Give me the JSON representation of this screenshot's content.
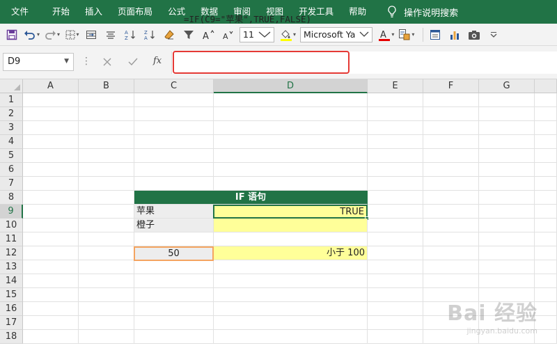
{
  "ribbon": {
    "tabs": [
      "文件",
      "开始",
      "插入",
      "页面布局",
      "公式",
      "数据",
      "审阅",
      "视图",
      "开发工具",
      "帮助"
    ],
    "search_label": "操作说明搜索",
    "color": "#217346"
  },
  "toolbar": {
    "font_size": "11",
    "font_name": "Microsoft Ya",
    "icons": [
      "save-icon",
      "undo-icon",
      "redo-icon",
      "borders-icon",
      "merge-icon",
      "align-icon",
      "sort-asc-icon",
      "sort-desc-icon",
      "clear-icon",
      "filter-icon",
      "font-grow-icon",
      "font-shrink-icon",
      "fill-color-icon",
      "font-color-icon",
      "format-painter-icon",
      "form-icon",
      "chart-icon",
      "camera-icon",
      "more-icon"
    ]
  },
  "formula_bar": {
    "name_box": "D9",
    "formula": "=IF(C9=\"苹果\",TRUE,FALSE)",
    "fx_label": "fx"
  },
  "sheet": {
    "columns": [
      "A",
      "B",
      "C",
      "D",
      "E",
      "F",
      "G"
    ],
    "rows": [
      "1",
      "2",
      "3",
      "4",
      "5",
      "6",
      "7",
      "8",
      "9",
      "10",
      "11",
      "12",
      "13",
      "14",
      "15",
      "16",
      "17",
      "18"
    ],
    "selected_column": "D",
    "selected_row": "9",
    "cells": {
      "header": "IF 语句",
      "c9": "苹果",
      "d9": "TRUE",
      "c10": "橙子",
      "c12": "50",
      "d12": "小于 100"
    },
    "colors": {
      "header": "#217346",
      "yellow": "#ffff99",
      "gray": "#ededed",
      "orange_border": "#f4a460"
    }
  },
  "watermark": {
    "brand": "Bai 经验",
    "site": "jingyan.baidu.com"
  }
}
